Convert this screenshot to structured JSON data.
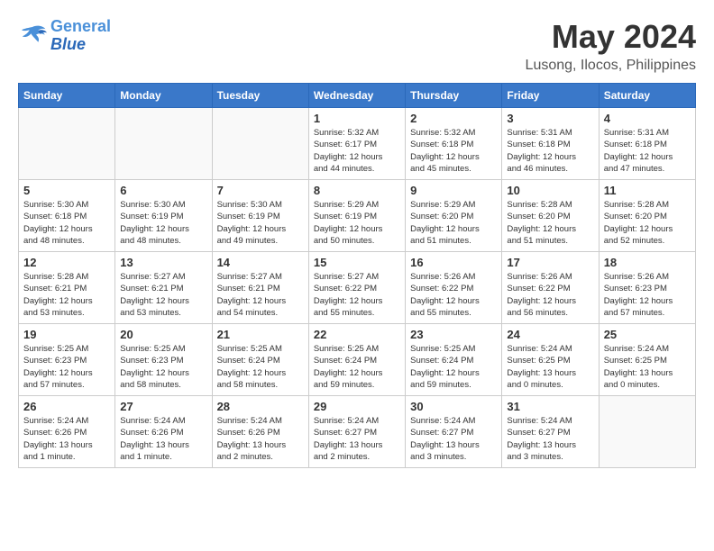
{
  "logo": {
    "line1": "General",
    "line2": "Blue"
  },
  "title": "May 2024",
  "location": "Lusong, Ilocos, Philippines",
  "days_of_week": [
    "Sunday",
    "Monday",
    "Tuesday",
    "Wednesday",
    "Thursday",
    "Friday",
    "Saturday"
  ],
  "weeks": [
    [
      {
        "day": "",
        "content": ""
      },
      {
        "day": "",
        "content": ""
      },
      {
        "day": "",
        "content": ""
      },
      {
        "day": "1",
        "content": "Sunrise: 5:32 AM\nSunset: 6:17 PM\nDaylight: 12 hours\nand 44 minutes."
      },
      {
        "day": "2",
        "content": "Sunrise: 5:32 AM\nSunset: 6:18 PM\nDaylight: 12 hours\nand 45 minutes."
      },
      {
        "day": "3",
        "content": "Sunrise: 5:31 AM\nSunset: 6:18 PM\nDaylight: 12 hours\nand 46 minutes."
      },
      {
        "day": "4",
        "content": "Sunrise: 5:31 AM\nSunset: 6:18 PM\nDaylight: 12 hours\nand 47 minutes."
      }
    ],
    [
      {
        "day": "5",
        "content": "Sunrise: 5:30 AM\nSunset: 6:18 PM\nDaylight: 12 hours\nand 48 minutes."
      },
      {
        "day": "6",
        "content": "Sunrise: 5:30 AM\nSunset: 6:19 PM\nDaylight: 12 hours\nand 48 minutes."
      },
      {
        "day": "7",
        "content": "Sunrise: 5:30 AM\nSunset: 6:19 PM\nDaylight: 12 hours\nand 49 minutes."
      },
      {
        "day": "8",
        "content": "Sunrise: 5:29 AM\nSunset: 6:19 PM\nDaylight: 12 hours\nand 50 minutes."
      },
      {
        "day": "9",
        "content": "Sunrise: 5:29 AM\nSunset: 6:20 PM\nDaylight: 12 hours\nand 51 minutes."
      },
      {
        "day": "10",
        "content": "Sunrise: 5:28 AM\nSunset: 6:20 PM\nDaylight: 12 hours\nand 51 minutes."
      },
      {
        "day": "11",
        "content": "Sunrise: 5:28 AM\nSunset: 6:20 PM\nDaylight: 12 hours\nand 52 minutes."
      }
    ],
    [
      {
        "day": "12",
        "content": "Sunrise: 5:28 AM\nSunset: 6:21 PM\nDaylight: 12 hours\nand 53 minutes."
      },
      {
        "day": "13",
        "content": "Sunrise: 5:27 AM\nSunset: 6:21 PM\nDaylight: 12 hours\nand 53 minutes."
      },
      {
        "day": "14",
        "content": "Sunrise: 5:27 AM\nSunset: 6:21 PM\nDaylight: 12 hours\nand 54 minutes."
      },
      {
        "day": "15",
        "content": "Sunrise: 5:27 AM\nSunset: 6:22 PM\nDaylight: 12 hours\nand 55 minutes."
      },
      {
        "day": "16",
        "content": "Sunrise: 5:26 AM\nSunset: 6:22 PM\nDaylight: 12 hours\nand 55 minutes."
      },
      {
        "day": "17",
        "content": "Sunrise: 5:26 AM\nSunset: 6:22 PM\nDaylight: 12 hours\nand 56 minutes."
      },
      {
        "day": "18",
        "content": "Sunrise: 5:26 AM\nSunset: 6:23 PM\nDaylight: 12 hours\nand 57 minutes."
      }
    ],
    [
      {
        "day": "19",
        "content": "Sunrise: 5:25 AM\nSunset: 6:23 PM\nDaylight: 12 hours\nand 57 minutes."
      },
      {
        "day": "20",
        "content": "Sunrise: 5:25 AM\nSunset: 6:23 PM\nDaylight: 12 hours\nand 58 minutes."
      },
      {
        "day": "21",
        "content": "Sunrise: 5:25 AM\nSunset: 6:24 PM\nDaylight: 12 hours\nand 58 minutes."
      },
      {
        "day": "22",
        "content": "Sunrise: 5:25 AM\nSunset: 6:24 PM\nDaylight: 12 hours\nand 59 minutes."
      },
      {
        "day": "23",
        "content": "Sunrise: 5:25 AM\nSunset: 6:24 PM\nDaylight: 12 hours\nand 59 minutes."
      },
      {
        "day": "24",
        "content": "Sunrise: 5:24 AM\nSunset: 6:25 PM\nDaylight: 13 hours\nand 0 minutes."
      },
      {
        "day": "25",
        "content": "Sunrise: 5:24 AM\nSunset: 6:25 PM\nDaylight: 13 hours\nand 0 minutes."
      }
    ],
    [
      {
        "day": "26",
        "content": "Sunrise: 5:24 AM\nSunset: 6:26 PM\nDaylight: 13 hours\nand 1 minute."
      },
      {
        "day": "27",
        "content": "Sunrise: 5:24 AM\nSunset: 6:26 PM\nDaylight: 13 hours\nand 1 minute."
      },
      {
        "day": "28",
        "content": "Sunrise: 5:24 AM\nSunset: 6:26 PM\nDaylight: 13 hours\nand 2 minutes."
      },
      {
        "day": "29",
        "content": "Sunrise: 5:24 AM\nSunset: 6:27 PM\nDaylight: 13 hours\nand 2 minutes."
      },
      {
        "day": "30",
        "content": "Sunrise: 5:24 AM\nSunset: 6:27 PM\nDaylight: 13 hours\nand 3 minutes."
      },
      {
        "day": "31",
        "content": "Sunrise: 5:24 AM\nSunset: 6:27 PM\nDaylight: 13 hours\nand 3 minutes."
      },
      {
        "day": "",
        "content": ""
      }
    ]
  ]
}
